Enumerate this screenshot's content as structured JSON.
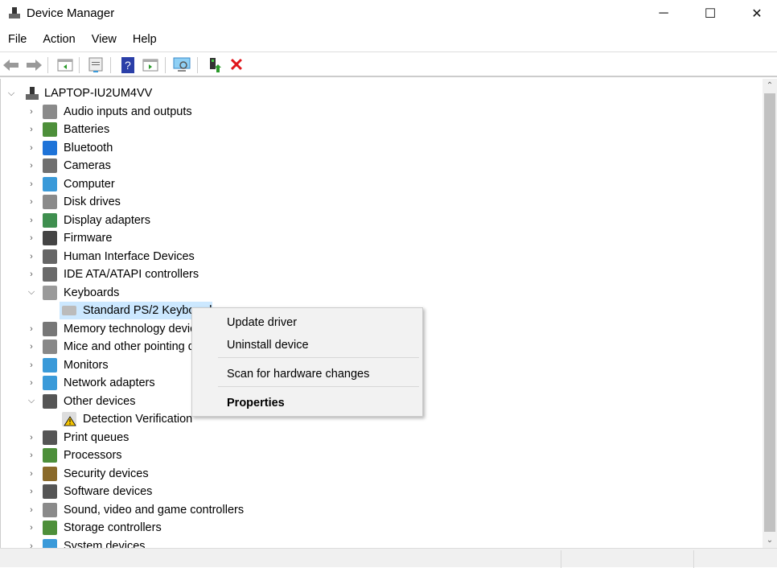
{
  "window": {
    "title": "Device Manager",
    "minimize": "─",
    "maximize": "☐",
    "close": "✕"
  },
  "menu": [
    "File",
    "Action",
    "View",
    "Help"
  ],
  "tree": {
    "root": "LAPTOP-IU2UM4VV",
    "items": [
      {
        "label": "Audio inputs and outputs",
        "icon": "speaker-icon",
        "color": "#8a8a8a"
      },
      {
        "label": "Batteries",
        "icon": "battery-icon",
        "color": "#4d8f3a"
      },
      {
        "label": "Bluetooth",
        "icon": "bluetooth-icon",
        "color": "#1e73d8"
      },
      {
        "label": "Cameras",
        "icon": "camera-icon",
        "color": "#707070"
      },
      {
        "label": "Computer",
        "icon": "computer-icon",
        "color": "#3a9ad9"
      },
      {
        "label": "Disk drives",
        "icon": "disk-drive-icon",
        "color": "#8a8a8a"
      },
      {
        "label": "Display adapters",
        "icon": "display-adapter-icon",
        "color": "#3f8f4f"
      },
      {
        "label": "Firmware",
        "icon": "firmware-icon",
        "color": "#444444"
      },
      {
        "label": "Human Interface Devices",
        "icon": "hid-icon",
        "color": "#666666"
      },
      {
        "label": "IDE ATA/ATAPI controllers",
        "icon": "ide-controller-icon",
        "color": "#6a6a6a"
      },
      {
        "label": "Keyboards",
        "icon": "keyboard-icon",
        "color": "#9a9a9a",
        "expanded": true,
        "children": [
          {
            "label": "Standard PS/2 Keyboard",
            "icon": "keyboard-icon",
            "selected": true
          }
        ]
      },
      {
        "label": "Memory technology devices",
        "icon": "memory-icon",
        "color": "#777777"
      },
      {
        "label": "Mice and other pointing devices",
        "icon": "mouse-icon",
        "color": "#888888"
      },
      {
        "label": "Monitors",
        "icon": "monitor-icon",
        "color": "#3a9ad9"
      },
      {
        "label": "Network adapters",
        "icon": "network-icon",
        "color": "#3a9ad9"
      },
      {
        "label": "Other devices",
        "icon": "other-devices-icon",
        "color": "#555555",
        "expanded": true,
        "children": [
          {
            "label": "Detection Verification",
            "icon": "warning-device-icon"
          }
        ]
      },
      {
        "label": "Print queues",
        "icon": "printer-icon",
        "color": "#555555"
      },
      {
        "label": "Processors",
        "icon": "processor-icon",
        "color": "#4d8f3a"
      },
      {
        "label": "Security devices",
        "icon": "security-icon",
        "color": "#8a6a2a"
      },
      {
        "label": "Software devices",
        "icon": "software-device-icon",
        "color": "#555555"
      },
      {
        "label": "Sound, video and game controllers",
        "icon": "speaker-icon",
        "color": "#8a8a8a"
      },
      {
        "label": "Storage controllers",
        "icon": "storage-controller-icon",
        "color": "#4d8f3a"
      },
      {
        "label": "System devices",
        "icon": "system-devices-icon",
        "color": "#3a9ad9"
      }
    ]
  },
  "context_menu": {
    "update": "Update driver",
    "uninstall": "Uninstall device",
    "scan": "Scan for hardware changes",
    "properties": "Properties"
  }
}
